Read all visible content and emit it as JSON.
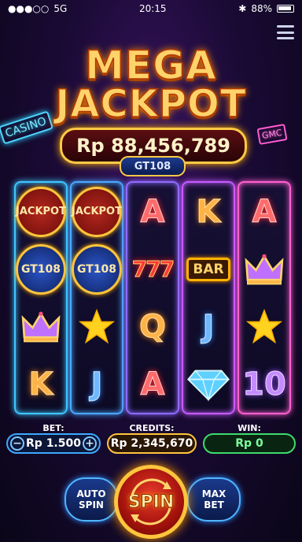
{
  "status_bar": {
    "carrier": "5G",
    "time": "20:15",
    "battery": "88%"
  },
  "background_signs": {
    "left": "CASINO",
    "right": "GMC"
  },
  "header": {
    "title_line1": "MEGA",
    "title_line2": "JACKPOT",
    "jackpot_amount": "Rp 88,456,789",
    "brand": "GT108"
  },
  "reels": [
    [
      {
        "type": "badge-jp",
        "label": "JACKPOT"
      },
      {
        "type": "badge-gt",
        "label": "GT108"
      },
      {
        "type": "crown-icon",
        "label": ""
      },
      {
        "type": "letter",
        "label": "K",
        "color": "orange"
      }
    ],
    [
      {
        "type": "badge-jp",
        "label": "JACKPOT"
      },
      {
        "type": "badge-gt",
        "label": "GT108"
      },
      {
        "type": "star-icon",
        "label": ""
      },
      {
        "type": "letter",
        "label": "J",
        "color": "blue"
      }
    ],
    [
      {
        "type": "letter",
        "label": "A",
        "color": "red"
      },
      {
        "type": "seven",
        "label": "777"
      },
      {
        "type": "letter",
        "label": "Q",
        "color": "orange"
      },
      {
        "type": "letter",
        "label": "A",
        "color": "red"
      }
    ],
    [
      {
        "type": "letter",
        "label": "K",
        "color": "orange"
      },
      {
        "type": "bar",
        "label": "BAR"
      },
      {
        "type": "letter",
        "label": "J",
        "color": "blue"
      },
      {
        "type": "diamond-icon",
        "label": ""
      }
    ],
    [
      {
        "type": "letter",
        "label": "A",
        "color": "red"
      },
      {
        "type": "crown-icon",
        "label": ""
      },
      {
        "type": "star-icon",
        "label": ""
      },
      {
        "type": "letter",
        "label": "10",
        "color": "purple"
      }
    ]
  ],
  "info": {
    "bet_label": "BET:",
    "bet_value": "Rp 1.500",
    "credits_label": "CREDITS:",
    "credits_value": "Rp 2,345,670",
    "win_label": "WIN:",
    "win_value": "Rp 0"
  },
  "controls": {
    "auto_spin_line1": "AUTO",
    "auto_spin_line2": "SPIN",
    "spin_label": "SPIN",
    "max_bet_line1": "MAX",
    "max_bet_line2": "BET"
  },
  "colors": {
    "gold": "#ffc53d",
    "neon_blue": "#3ec7ff",
    "neon_pink": "#ff5fd0",
    "win_green": "#3ddc6a"
  }
}
